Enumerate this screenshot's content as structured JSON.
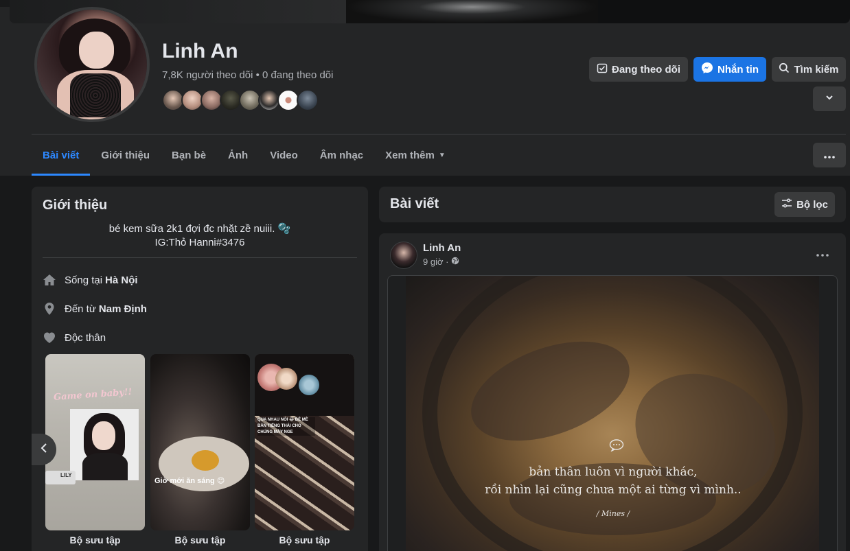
{
  "profile": {
    "name": "Linh An",
    "followers_text": "7,8K người theo dõi • 0 đang theo dõi"
  },
  "actions": {
    "following_label": "Đang theo dõi",
    "message_label": "Nhắn tin",
    "search_label": "Tìm kiếm"
  },
  "tabs": [
    {
      "label": "Bài viết",
      "active": true
    },
    {
      "label": "Giới thiệu"
    },
    {
      "label": "Bạn bè"
    },
    {
      "label": "Ảnh"
    },
    {
      "label": "Video"
    },
    {
      "label": "Âm nhạc"
    },
    {
      "label": "Xem thêm"
    }
  ],
  "intro": {
    "title": "Giới thiệu",
    "bio_line1": "bé kem sữa 2k1 đợi đc nhặt zề nuiii. 🫧",
    "bio_line2": "IG:Thỏ Hanni#3476",
    "lives_prefix": "Sống tại",
    "lives_place": "Hà Nội",
    "from_prefix": "Đến từ",
    "from_place": "Nam Định",
    "relationship": "Độc thân",
    "collections": [
      {
        "label": "Bộ sưu tập",
        "overlay": "Game on baby!!",
        "tag": "LILY"
      },
      {
        "label": "Bộ sưu tập",
        "overlay": "Giờ mới ăn sáng 😊"
      },
      {
        "label": "Bộ sưu tập",
        "overlay": "QUA NHAU NÓI 😂 BÉ MÈ BẢN TIẾNG THÁI CHO CHÚNG MÀY NGE"
      }
    ]
  },
  "posts": {
    "title": "Bài viết",
    "filter_label": "Bộ lọc",
    "items": [
      {
        "author": "Linh An",
        "time": "9 giờ ·",
        "quote_line1": "bản thân luôn vì người khác,",
        "quote_line2": "rồi nhìn lại cũng chưa một ai từng vì mình..",
        "signature": "/ Mines /"
      }
    ]
  },
  "colors": {
    "accent": "#2d88ff",
    "primary_button": "#1b74e4",
    "surface": "#242526",
    "background": "#18191a"
  }
}
